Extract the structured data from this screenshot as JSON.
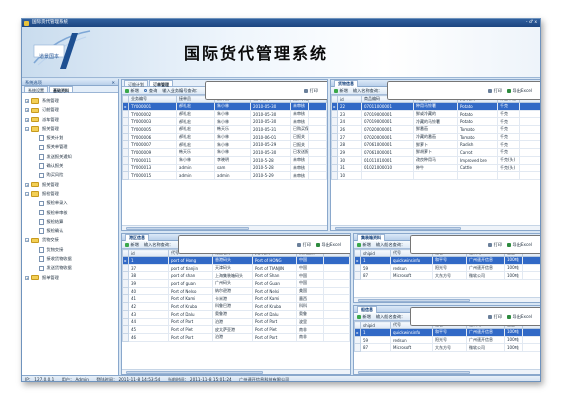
{
  "window": {
    "title": "国际货代管理系统",
    "controls": "- ♂ x"
  },
  "banner": {
    "logo_text": "道景国本",
    "title": "国际货代管理系统"
  },
  "sidebar": {
    "header": "系统选项",
    "tabs": [
      "系统设置",
      "基础资料"
    ],
    "items": [
      {
        "label": "系统管理",
        "level": 0,
        "type": "folder",
        "expanded": false
      },
      {
        "label": "订舱管理",
        "level": 0,
        "type": "folder",
        "expanded": false
      },
      {
        "label": "派车管理",
        "level": 0,
        "type": "folder",
        "expanded": false
      },
      {
        "label": "报关管理",
        "level": 0,
        "type": "folder",
        "expanded": true
      },
      {
        "label": "报关计划",
        "level": 1,
        "type": "page"
      },
      {
        "label": "报关单管理",
        "level": 1,
        "type": "page"
      },
      {
        "label": "发送报关通知",
        "level": 1,
        "type": "page"
      },
      {
        "label": "确认报关",
        "level": 1,
        "type": "page"
      },
      {
        "label": "购买风险",
        "level": 1,
        "type": "page"
      },
      {
        "label": "报关管理",
        "level": 0,
        "type": "folder",
        "expanded": false
      },
      {
        "label": "报检管理",
        "level": 0,
        "type": "folder",
        "expanded": true
      },
      {
        "label": "报检单录入",
        "level": 1,
        "type": "page"
      },
      {
        "label": "报检单审核",
        "level": 1,
        "type": "page"
      },
      {
        "label": "报检结算",
        "level": 1,
        "type": "page"
      },
      {
        "label": "报检确认",
        "level": 1,
        "type": "page"
      },
      {
        "label": "货物交接",
        "level": 0,
        "type": "folder",
        "expanded": true
      },
      {
        "label": "货物交接",
        "level": 1,
        "type": "page"
      },
      {
        "label": "接收货物收据",
        "level": 1,
        "type": "page"
      },
      {
        "label": "发送货物收据",
        "level": 1,
        "type": "page"
      },
      {
        "label": "报单管理",
        "level": 0,
        "type": "folder",
        "expanded": false
      }
    ]
  },
  "toolbar": {
    "add": "新增",
    "del": "删除",
    "search": "查询",
    "print": "打印",
    "excel": "导出Excel"
  },
  "pane_orders": {
    "tabs": [
      "订舱计划",
      "订单管理"
    ],
    "search_label": "输入业务编号查询：",
    "columns": [
      "业务编号",
      "接单员",
      "操作员",
      "输入时间",
      "报价状态"
    ],
    "rows": [
      [
        "TY000001",
        "郝礼宏",
        "朱小林",
        "2010-05-30",
        "未审核"
      ],
      [
        "TY000002",
        "郝礼宏",
        "朱小林",
        "2010-05-30",
        "未审核"
      ],
      [
        "TY000003",
        "郝礼宏",
        "朱小林",
        "2010-05-30",
        "未审核"
      ],
      [
        "TY000005",
        "郝礼宏",
        "韩天乐",
        "2010-05-31",
        "已购买保险"
      ],
      [
        "TY000006",
        "郝礼宏",
        "朱小林",
        "2010-06-01",
        "已报关"
      ],
      [
        "TY000007",
        "郝礼宏",
        "朱小林",
        "2010-05-29",
        "已报关"
      ],
      [
        "TY000009",
        "韩天乐",
        "朱小林",
        "2010-05-30",
        "已发送报单"
      ],
      [
        "TY000011",
        "朱小林",
        "李晓明",
        "2010-5-28",
        "未审核"
      ],
      [
        "TY000013",
        "admin",
        "sam",
        "2010-5-28",
        "未审核"
      ],
      [
        "TY000015",
        "admin",
        "admin",
        "2010-5-29",
        "未审核"
      ]
    ]
  },
  "pane_goods": {
    "title": "货物信息",
    "search_label": "输入名称查询：",
    "columns": [
      "id",
      "商品编码",
      "商品名称",
      "英文名称",
      "计量单位"
    ],
    "rows": [
      [
        "22",
        "07011000001",
        "种用马铃薯",
        "Potato",
        "千克"
      ],
      [
        "23",
        "07019000001",
        "鲜或冷藏的",
        "Potato",
        "千克"
      ],
      [
        "24",
        "07019000001",
        "冷藏的马铃薯",
        "Potato",
        "千克"
      ],
      [
        "26",
        "07020000001",
        "鲜番茄",
        "Tomato",
        "千克"
      ],
      [
        "27",
        "07020000001",
        "冷藏的番茄",
        "Tomato",
        "千克"
      ],
      [
        "28",
        "07061000001",
        "鲜萝卜",
        "Radish",
        "千克"
      ],
      [
        "29",
        "07061000001",
        "鲜胡萝卜",
        "Carrot",
        "千克"
      ],
      [
        "30",
        "01011010001",
        "改良种用马",
        "Improved bre",
        "千克(头)"
      ],
      [
        "31",
        "01021000010",
        "种牛",
        "Cattle",
        "千克(头)"
      ],
      [
        "10",
        "",
        "",
        "",
        ""
      ]
    ]
  },
  "pane_port": {
    "title": "港区信息",
    "search_label": "输入名称查询：",
    "columns": [
      "id",
      "代号",
      "港区名称",
      "英文名称",
      "所属国家"
    ],
    "rows": [
      [
        "1",
        "port of Hong",
        "香港码头",
        "Port of HONG",
        "中国"
      ],
      [
        "37",
        "port of tianjin",
        "天津码头",
        "Port of TIANJIN",
        "中国"
      ],
      [
        "38",
        "port of shan",
        "上海集装箱码头",
        "Port of Shan",
        "中国"
      ],
      [
        "39",
        "port of guan",
        "广州码头",
        "Port of Guan",
        "中国"
      ],
      [
        "40",
        "Port of Nelso",
        "纳尔逊港",
        "Port of Nelsi",
        "美国"
      ],
      [
        "41",
        "Port of Kami",
        "卡米港",
        "Port of Kami",
        "墨西"
      ],
      [
        "42",
        "Port of Kruba",
        "科鲁巴港",
        "Port of Kruba",
        "科科"
      ],
      [
        "43",
        "Port of Dalu",
        "奥鲁港",
        "Port of Dalu",
        "奥鲁"
      ],
      [
        "44",
        "Port of Part",
        "泊港",
        "Port of Part",
        "波里"
      ],
      [
        "45",
        "Port of Piet",
        "皮太萨亚港",
        "Port of Piet",
        "南非"
      ],
      [
        "46",
        "Port of Port",
        "泊港",
        "Port of Port",
        "南非"
      ]
    ]
  },
  "pane_ship": {
    "title": "集装箱资料",
    "search_label": "输入船名查询：",
    "columns": [
      "shipid",
      "代号",
      "船名",
      "船公司",
      "重量"
    ],
    "rows": [
      [
        "1",
        "quickwinsinfo",
        "和平号",
        "广州速开信息",
        "100吨"
      ],
      [
        "59",
        "redsun",
        "阳光号",
        "广州速开信息",
        "100吨"
      ],
      [
        "87",
        "Microsoft",
        "大东方号",
        "微软公司",
        "100吨"
      ]
    ]
  },
  "pane_ship2": {
    "title": "船信息",
    "search_label": "输入船名查询：",
    "columns": [
      "shipid",
      "代号",
      "船名",
      "船公司",
      "重量"
    ],
    "rows": [
      [
        "1",
        "quickwinsinfo",
        "和平号",
        "广州速开信息",
        "100吨"
      ],
      [
        "59",
        "redsun",
        "阳光号",
        "广州速开信息",
        "100吨"
      ],
      [
        "87",
        "Microsoft",
        "大东方号",
        "微软公司",
        "100吨"
      ]
    ]
  },
  "status": {
    "ip": "IP： 127.0.0.1",
    "user": "用户： Admin",
    "login": "登陆时间： 2011-11-8 14:53:54",
    "current": "当前时间： 2011-11-8 15:01:24",
    "company": "广州速开信息科技有限公司"
  }
}
